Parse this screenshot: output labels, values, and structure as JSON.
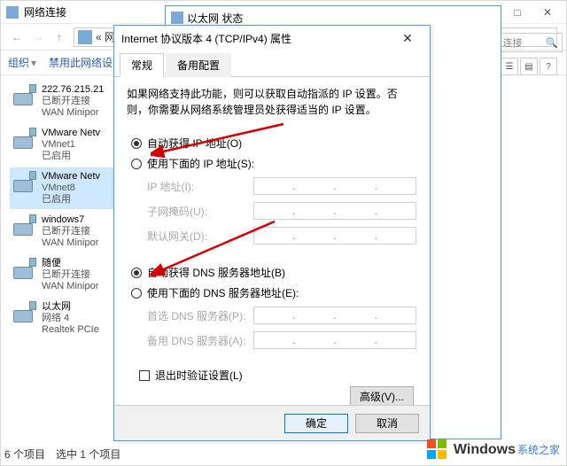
{
  "colors": {
    "accent": "#0078d7",
    "border": "#4a9dd8"
  },
  "back": {
    "title": "网络连接",
    "breadcrumb_hint": "« 网络连接",
    "toolbar": {
      "org": "组织",
      "disable": "禁用此网络设",
      "chevron": "▾"
    },
    "search_placeholder": "连接",
    "status": {
      "count": "6 个项目",
      "selected": "选中 1 个项目"
    }
  },
  "mid": {
    "title": "以太网 状态",
    "icon_name": "nic-icon"
  },
  "connections": [
    {
      "l1": "222.76.215.21",
      "l2": "已断开连接",
      "l3": "WAN Minipor"
    },
    {
      "l1": "VMware Netv",
      "l2": "VMnet1",
      "l3": "已启用"
    },
    {
      "l1": "VMware Netv",
      "l2": "VMnet8",
      "l3": "已启用"
    },
    {
      "l1": "windows7",
      "l2": "已断开连接",
      "l3": "WAN Minipor"
    },
    {
      "l1": "随便",
      "l2": "已断开连接",
      "l3": "WAN Minipor"
    },
    {
      "l1": "以太网",
      "l2": "网络 4",
      "l3": "Realtek PCIe"
    }
  ],
  "dlg": {
    "title": "Internet 协议版本 4 (TCP/IPv4) 属性",
    "tabs": {
      "general": "常规",
      "alt": "备用配置"
    },
    "desc": "如果网络支持此功能，则可以获取自动指派的 IP 设置。否则，你需要从网络系统管理员处获得适当的 IP 设置。",
    "ip": {
      "auto": "自动获得 IP 地址(O)",
      "manual": "使用下面的 IP 地址(S):",
      "addr": "IP 地址(I):",
      "mask": "子网掩码(U):",
      "gw": "默认网关(D):"
    },
    "dns": {
      "auto": "自动获得 DNS 服务器地址(B)",
      "manual": "使用下面的 DNS 服务器地址(E):",
      "pref": "首选 DNS 服务器(P):",
      "alt": "备用 DNS 服务器(A):"
    },
    "validate": "退出时验证设置(L)",
    "advanced": "高级(V)...",
    "ok": "确定",
    "cancel": "取消"
  },
  "watermark": {
    "brand": "Windows",
    "sub": "系统之家"
  }
}
